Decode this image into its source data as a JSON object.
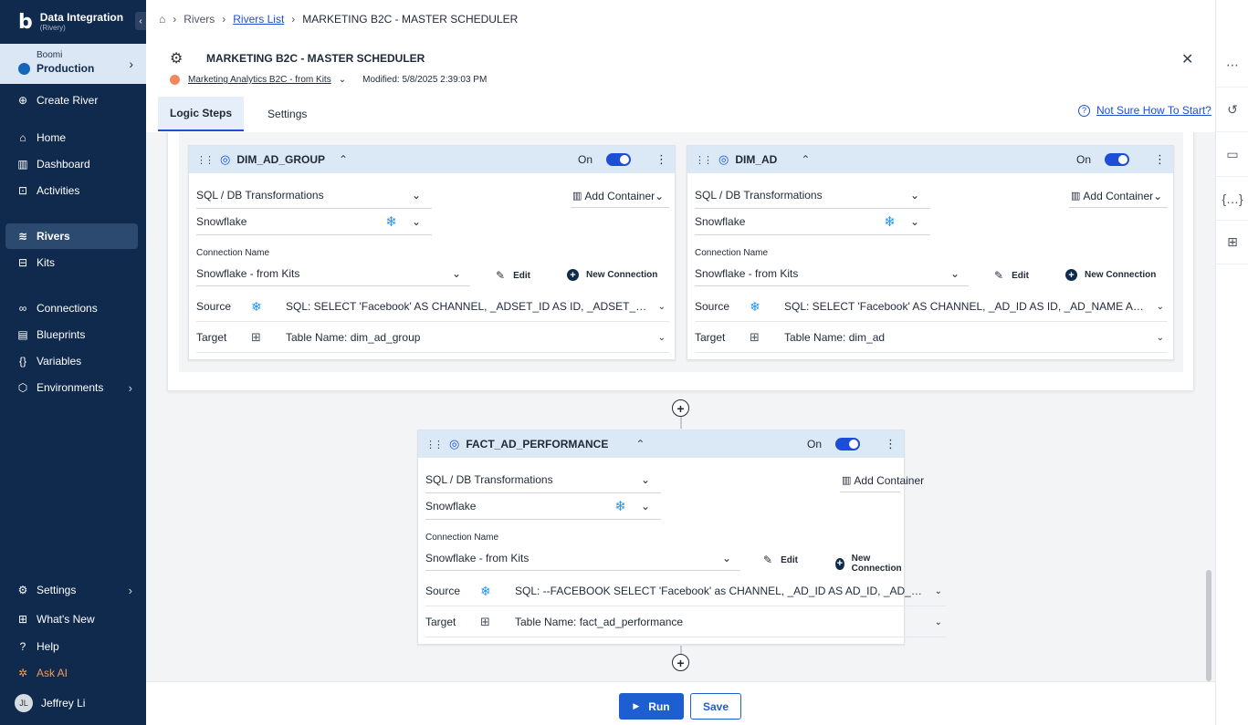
{
  "brand": {
    "logo": "b",
    "title": "Data Integration",
    "subtitle": "(Rivery)"
  },
  "environment": {
    "org": "Boomi",
    "name": "Production"
  },
  "nav": {
    "create_river": "Create River",
    "home": "Home",
    "dashboard": "Dashboard",
    "activities": "Activities",
    "rivers": "Rivers",
    "kits": "Kits",
    "connections": "Connections",
    "blueprints": "Blueprints",
    "variables": "Variables",
    "environments": "Environments",
    "settings": "Settings",
    "whats_new": "What's New",
    "help": "Help",
    "ask_ai": "Ask AI"
  },
  "user": {
    "initials": "JL",
    "name": "Jeffrey Li"
  },
  "breadcrumb": {
    "root": "Rivers",
    "list": "Rivers List",
    "current": "MARKETING B2C - MASTER SCHEDULER"
  },
  "river": {
    "title": "MARKETING B2C - MASTER SCHEDULER",
    "kit": "Marketing Analytics B2C - from Kits",
    "modified": "Modified: 5/8/2025 2:39:03 PM"
  },
  "tabs": {
    "logic_steps": "Logic Steps",
    "settings": "Settings"
  },
  "help_link": "Not Sure How To Start?",
  "common": {
    "on": "On",
    "add_container": "Add Container",
    "connection_name": "Connection Name",
    "edit": "Edit",
    "new_connection": "New Connection",
    "source": "Source",
    "target": "Target"
  },
  "steps": [
    {
      "name": "DIM_AD_GROUP",
      "type": "SQL / DB Transformations",
      "db": "Snowflake",
      "connection": "Snowflake - from Kits",
      "source": "SQL:  SELECT 'Facebook' AS CHANNEL, _ADSET_ID AS ID, _ADSET_NAME AS...",
      "target": "Table Name: dim_ad_group"
    },
    {
      "name": "DIM_AD",
      "type": "SQL / DB Transformations",
      "db": "Snowflake",
      "connection": "Snowflake - from Kits",
      "source": "SQL:  SELECT 'Facebook' AS CHANNEL, _AD_ID AS ID, _AD_NAME AS NAME...",
      "target": "Table Name: dim_ad"
    },
    {
      "name": "FACT_AD_PERFORMANCE",
      "type": "SQL / DB Transformations",
      "db": "Snowflake",
      "connection": "Snowflake - from Kits",
      "source": "SQL:  --FACEBOOK SELECT 'Facebook' as CHANNEL, _AD_ID AS AD_ID, _AD_NAME A...",
      "target": "Table Name: fact_ad_performance"
    }
  ],
  "footer": {
    "run": "Run",
    "save": "Save"
  },
  "icons": {
    "home": "home-icon",
    "dashboard": "dashboard-icon",
    "activities": "activities-icon",
    "rivers": "rivers-icon",
    "kits": "kits-icon",
    "connections": "link-icon",
    "blueprints": "blueprint-icon",
    "variables": "braces-icon",
    "environments": "cube-icon",
    "snowflake": "snowflake-icon",
    "table": "table-icon"
  },
  "colors": {
    "sidebar": "#0f2a4d",
    "accent": "#1d5fd1",
    "step_header": "#dbe9f7",
    "snowflake": "#2196f3"
  }
}
